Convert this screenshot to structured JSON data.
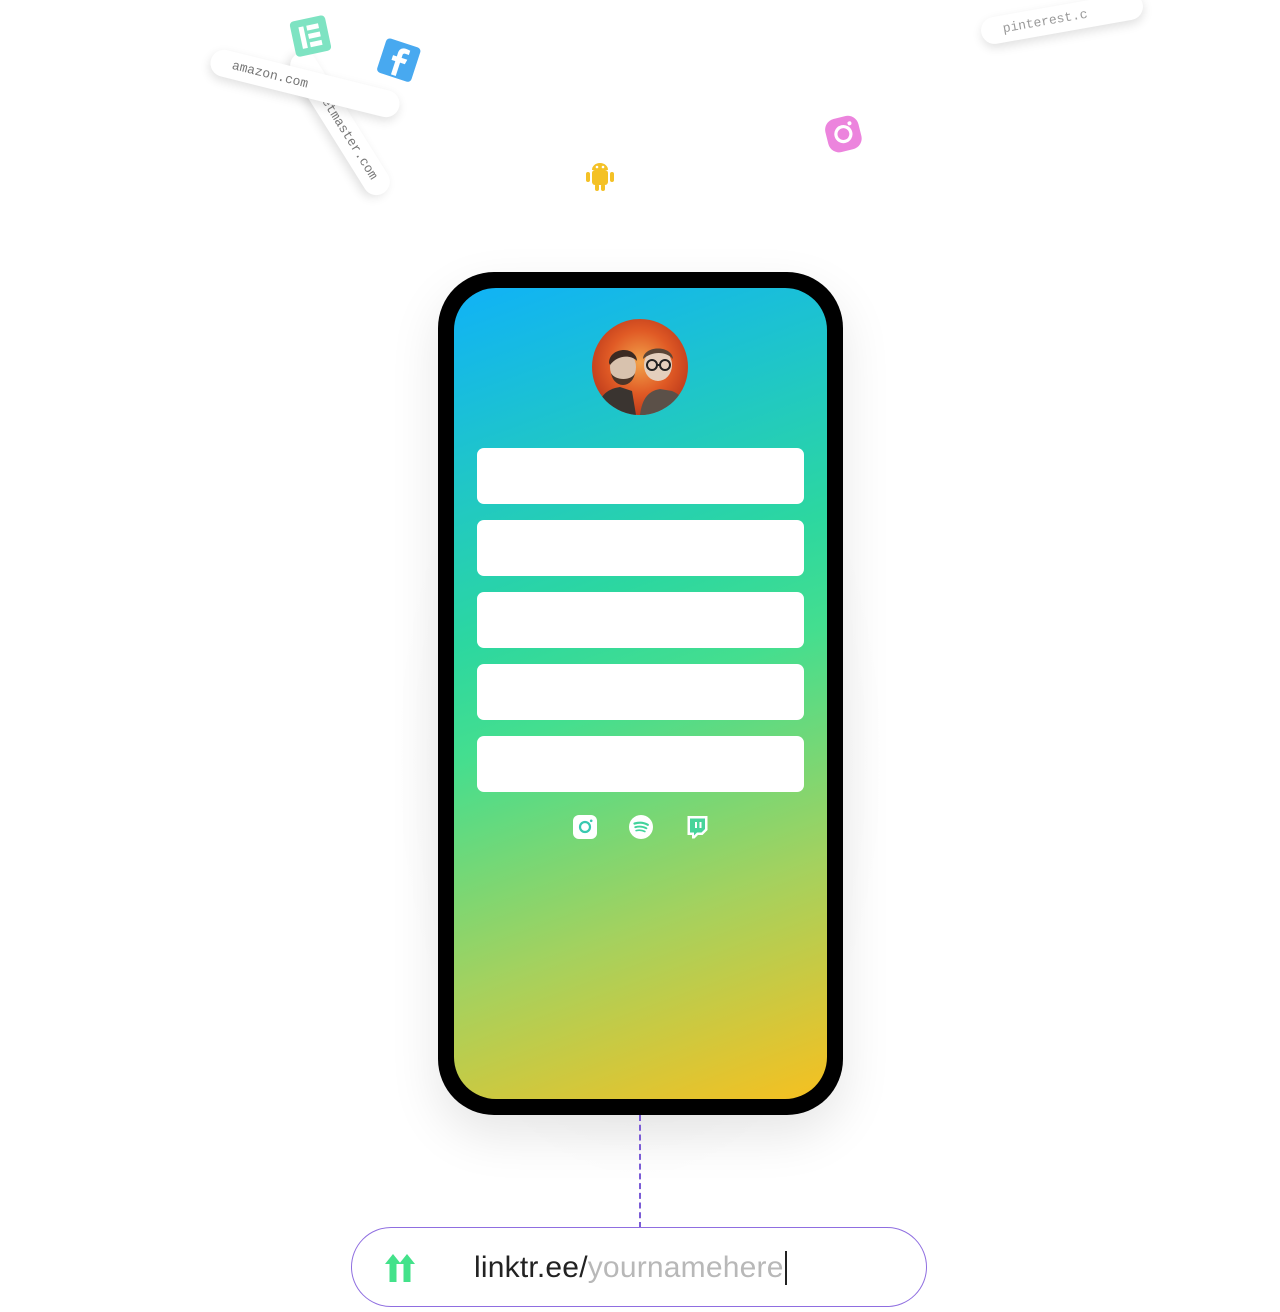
{
  "floating_pills": [
    {
      "text": "amazon.com"
    },
    {
      "text": "ticketmaster.com"
    },
    {
      "text": "pinterest.c"
    }
  ],
  "floating_icons": [
    "elementor-icon",
    "facebook-icon",
    "android-icon",
    "camera-icon"
  ],
  "phone": {
    "link_buttons": [
      "",
      "",
      "",
      "",
      ""
    ],
    "social_icons": [
      "instagram-icon",
      "spotify-icon",
      "twitch-icon"
    ]
  },
  "url_bar": {
    "prefix": "linktr.ee/",
    "placeholder": "yournamehere"
  },
  "colors": {
    "gradient_top": "#10b2f7",
    "gradient_mid": "#44de8f",
    "gradient_bottom": "#f6c020",
    "logo_green": "#43e28a",
    "outline_purple": "#8f6ee0"
  }
}
